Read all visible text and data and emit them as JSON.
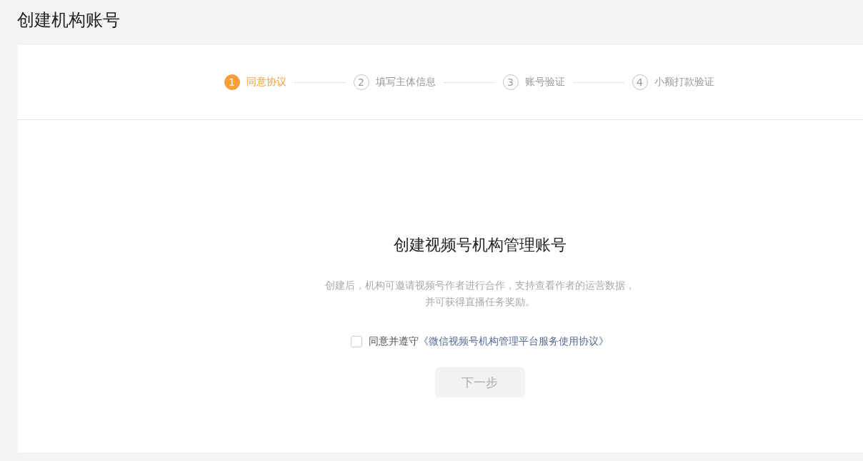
{
  "page_title": "创建机构账号",
  "steps": [
    {
      "number": "1",
      "label": "同意协议",
      "selected": true
    },
    {
      "number": "2",
      "label": "填写主体信息",
      "selected": false
    },
    {
      "number": "3",
      "label": "账号验证",
      "selected": false
    },
    {
      "number": "4",
      "label": "小额打款验证",
      "selected": false
    }
  ],
  "heading": "创建视频号机构管理账号",
  "description": "创建后，机构可邀请视频号作者进行合作，支持查看作者的运营数据，并可获得直播任务奖励。",
  "agreement": {
    "checked": false,
    "text": "同意并遵守",
    "link": "《微信视频号机构管理平台服务使用协议》"
  },
  "next_button": {
    "label": "下一步",
    "disabled": true
  }
}
